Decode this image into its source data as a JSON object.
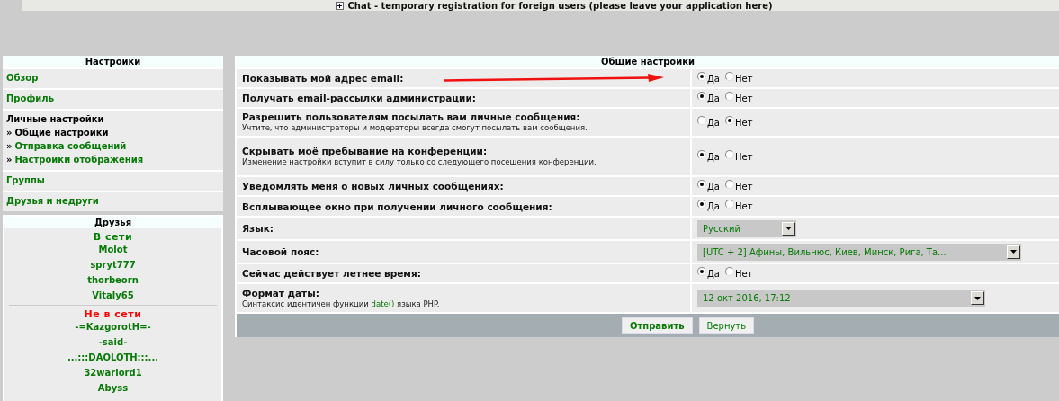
{
  "chat_bar": {
    "text": "Chat - temporary registration for foreign users (please leave your application here)"
  },
  "sidebar": {
    "title": "Настройки",
    "items": [
      {
        "kind": "link",
        "label": "Обзор",
        "selected": false
      },
      {
        "kind": "link",
        "label": "Профиль",
        "selected": false
      },
      {
        "kind": "group",
        "label": "Личные настройки",
        "children": [
          {
            "bullet": "»",
            "label": "Общие настройки",
            "selected": true
          },
          {
            "bullet": "»",
            "label": "Отправка сообщений",
            "selected": false
          },
          {
            "bullet": "»",
            "label": "Настройки отображения",
            "selected": false
          }
        ]
      },
      {
        "kind": "link",
        "label": "Группы",
        "selected": false
      },
      {
        "kind": "link",
        "label": "Друзья и недруги",
        "selected": false
      }
    ]
  },
  "friends": {
    "title": "Друзья",
    "groups": [
      {
        "heading": "В сети",
        "color": "#008000",
        "names": [
          "Molot",
          "spryt777",
          "thorbeorn",
          "Vitaly65"
        ]
      },
      {
        "heading": "Не в сети",
        "color": "#ff0000",
        "names": [
          "-=KazgorotH=-",
          "-said-",
          "...:::DAOLOTH:::...",
          "32warlord1",
          "Abyss"
        ]
      }
    ]
  },
  "settings": {
    "title": "Общие настройки",
    "rows": [
      {
        "kind": "radio",
        "label": "Показывать мой адрес email:",
        "options": [
          {
            "label": "Да",
            "selected": true
          },
          {
            "label": "Нет",
            "selected": false
          }
        ]
      },
      {
        "kind": "radio",
        "label": "Получать email-рассылки администрации:",
        "options": [
          {
            "label": "Да",
            "selected": true
          },
          {
            "label": "Нет",
            "selected": false
          }
        ]
      },
      {
        "kind": "radio",
        "label": "Разрешить пользователям посылать вам личные сообщения:",
        "hint": "Учтите, что администраторы и модераторы всегда смогут посылать вам сообщения.",
        "options": [
          {
            "label": "Да",
            "selected": false
          },
          {
            "label": "Нет",
            "selected": true
          }
        ]
      },
      {
        "kind": "radio",
        "label": "Скрывать моё пребывание на конференции:",
        "hint": "Изменение настройки вступит в силу только со следующего посещения конференции.",
        "options": [
          {
            "label": "Да",
            "selected": true
          },
          {
            "label": "Нет",
            "selected": false
          }
        ]
      },
      {
        "kind": "radio",
        "label": "Уведомлять меня о новых личных сообщениях:",
        "options": [
          {
            "label": "Да",
            "selected": true
          },
          {
            "label": "Нет",
            "selected": false
          }
        ]
      },
      {
        "kind": "radio",
        "label": "Всплывающее окно при получении личного сообщения:",
        "options": [
          {
            "label": "Да",
            "selected": true
          },
          {
            "label": "Нет",
            "selected": false
          }
        ]
      },
      {
        "kind": "select",
        "label": "Язык:",
        "value": "Русский"
      },
      {
        "kind": "select",
        "label": "Часовой пояс:",
        "value": "[UTC + 2] Афины, Вильнюс, Киев, Минск, Рига, Та..."
      },
      {
        "kind": "radio",
        "label": "Сейчас действует летнее время:",
        "options": [
          {
            "label": "Да",
            "selected": true
          },
          {
            "label": "Нет",
            "selected": false
          }
        ]
      },
      {
        "kind": "select",
        "label": "Формат даты:",
        "hint": "Синтаксис идентичен функции ",
        "hint_link": "date()",
        "hint_end": " языка PHP.",
        "value": "12 окт 2016, 17:12"
      }
    ],
    "buttons": [
      {
        "label": "Отправить",
        "kind": "primary"
      },
      {
        "label": "Вернуть",
        "kind": "secondary"
      }
    ]
  },
  "annotations": [
    {
      "kind": "arrow"
    }
  ]
}
